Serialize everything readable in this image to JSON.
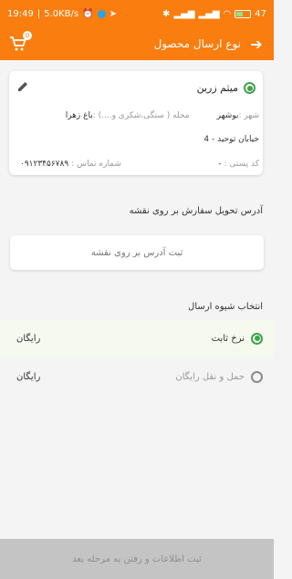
{
  "status_bar": {
    "time": "19:49",
    "network_speed": "5.0KB/s",
    "battery": "47"
  },
  "app_bar": {
    "title": "نوع ارسال محصول",
    "cart_badge": "0"
  },
  "address_card": {
    "name": "میثم زرین",
    "city_label": "شهر :",
    "city": "بوشهر",
    "neighborhood_label": "محله ( سنگی،شکری و....) :",
    "neighborhood": "باغ زهرا",
    "street": "خیابان توحید - 4",
    "postal_label": "کد پستی :",
    "postal_value": "-",
    "phone_label": "شماره تماس :",
    "phone": "۰۹۱۲۳۴۵۶۷۸۹"
  },
  "map_section": {
    "label": "آدرس تحویل سفارش بر روی نقشه",
    "button": "ثبت آدرس بر روی نقشه"
  },
  "shipping": {
    "label": "انتخاب شیوه ارسال",
    "options": [
      {
        "label": "نرخ ثابت",
        "price": "رایگان",
        "selected": true
      },
      {
        "label": "حمل و نقل رایگان",
        "price": "رایگان",
        "selected": false
      }
    ]
  },
  "submit": {
    "label": "ثبت اطلاعات و رفتن به مرحله بعد"
  },
  "colors": {
    "primary": "#f97d0f",
    "selected_radio": "#3fa34d",
    "selected_row_bg": "#f5f9ee",
    "disabled_button": "#c4c4c4"
  }
}
